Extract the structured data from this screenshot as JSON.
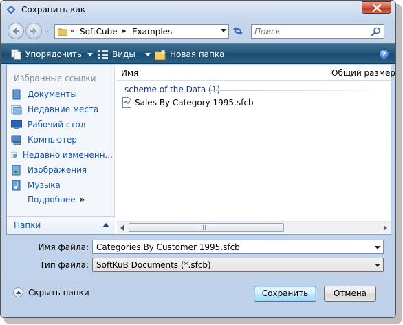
{
  "window": {
    "title": "Сохранить как"
  },
  "address": {
    "overflow": "«",
    "segments": [
      "SoftCube",
      "Examples"
    ],
    "separator": "▸"
  },
  "search": {
    "placeholder": "Поиск"
  },
  "toolbar": {
    "organize": "Упорядочить",
    "views": "Виды",
    "new_folder": "Новая папка",
    "help": "?"
  },
  "nav": {
    "heading": "Избранные ссылки",
    "items": [
      {
        "label": "Документы",
        "icon": "documents-icon"
      },
      {
        "label": "Недавние места",
        "icon": "recent-places-icon"
      },
      {
        "label": "Рабочий стол",
        "icon": "desktop-icon"
      },
      {
        "label": "Компьютер",
        "icon": "computer-icon"
      },
      {
        "label": "Недавно измененн...",
        "icon": "recently-changed-icon"
      },
      {
        "label": "Изображения",
        "icon": "pictures-icon"
      },
      {
        "label": "Музыка",
        "icon": "music-icon"
      }
    ],
    "more": "Подробнее",
    "more_glyph": "»",
    "folders": "Папки"
  },
  "files": {
    "columns": [
      "Имя",
      "Общий размер"
    ],
    "group": "scheme of the Data (1)",
    "items": [
      {
        "name": "Sales By Category 1995.sfcb"
      }
    ]
  },
  "form": {
    "filename_label": "Имя файла:",
    "filename_value": "Categories By Customer 1995.sfcb",
    "filetype_label": "Тип файла:",
    "filetype_value": "SoftKuB Documents (*.sfcb)"
  },
  "footer": {
    "hide_folders": "Скрыть папки",
    "save": "Сохранить",
    "cancel": "Отмена"
  },
  "colors": {
    "toolbar": "#26597c",
    "link": "#1a55a6",
    "close": "#c9513c"
  }
}
